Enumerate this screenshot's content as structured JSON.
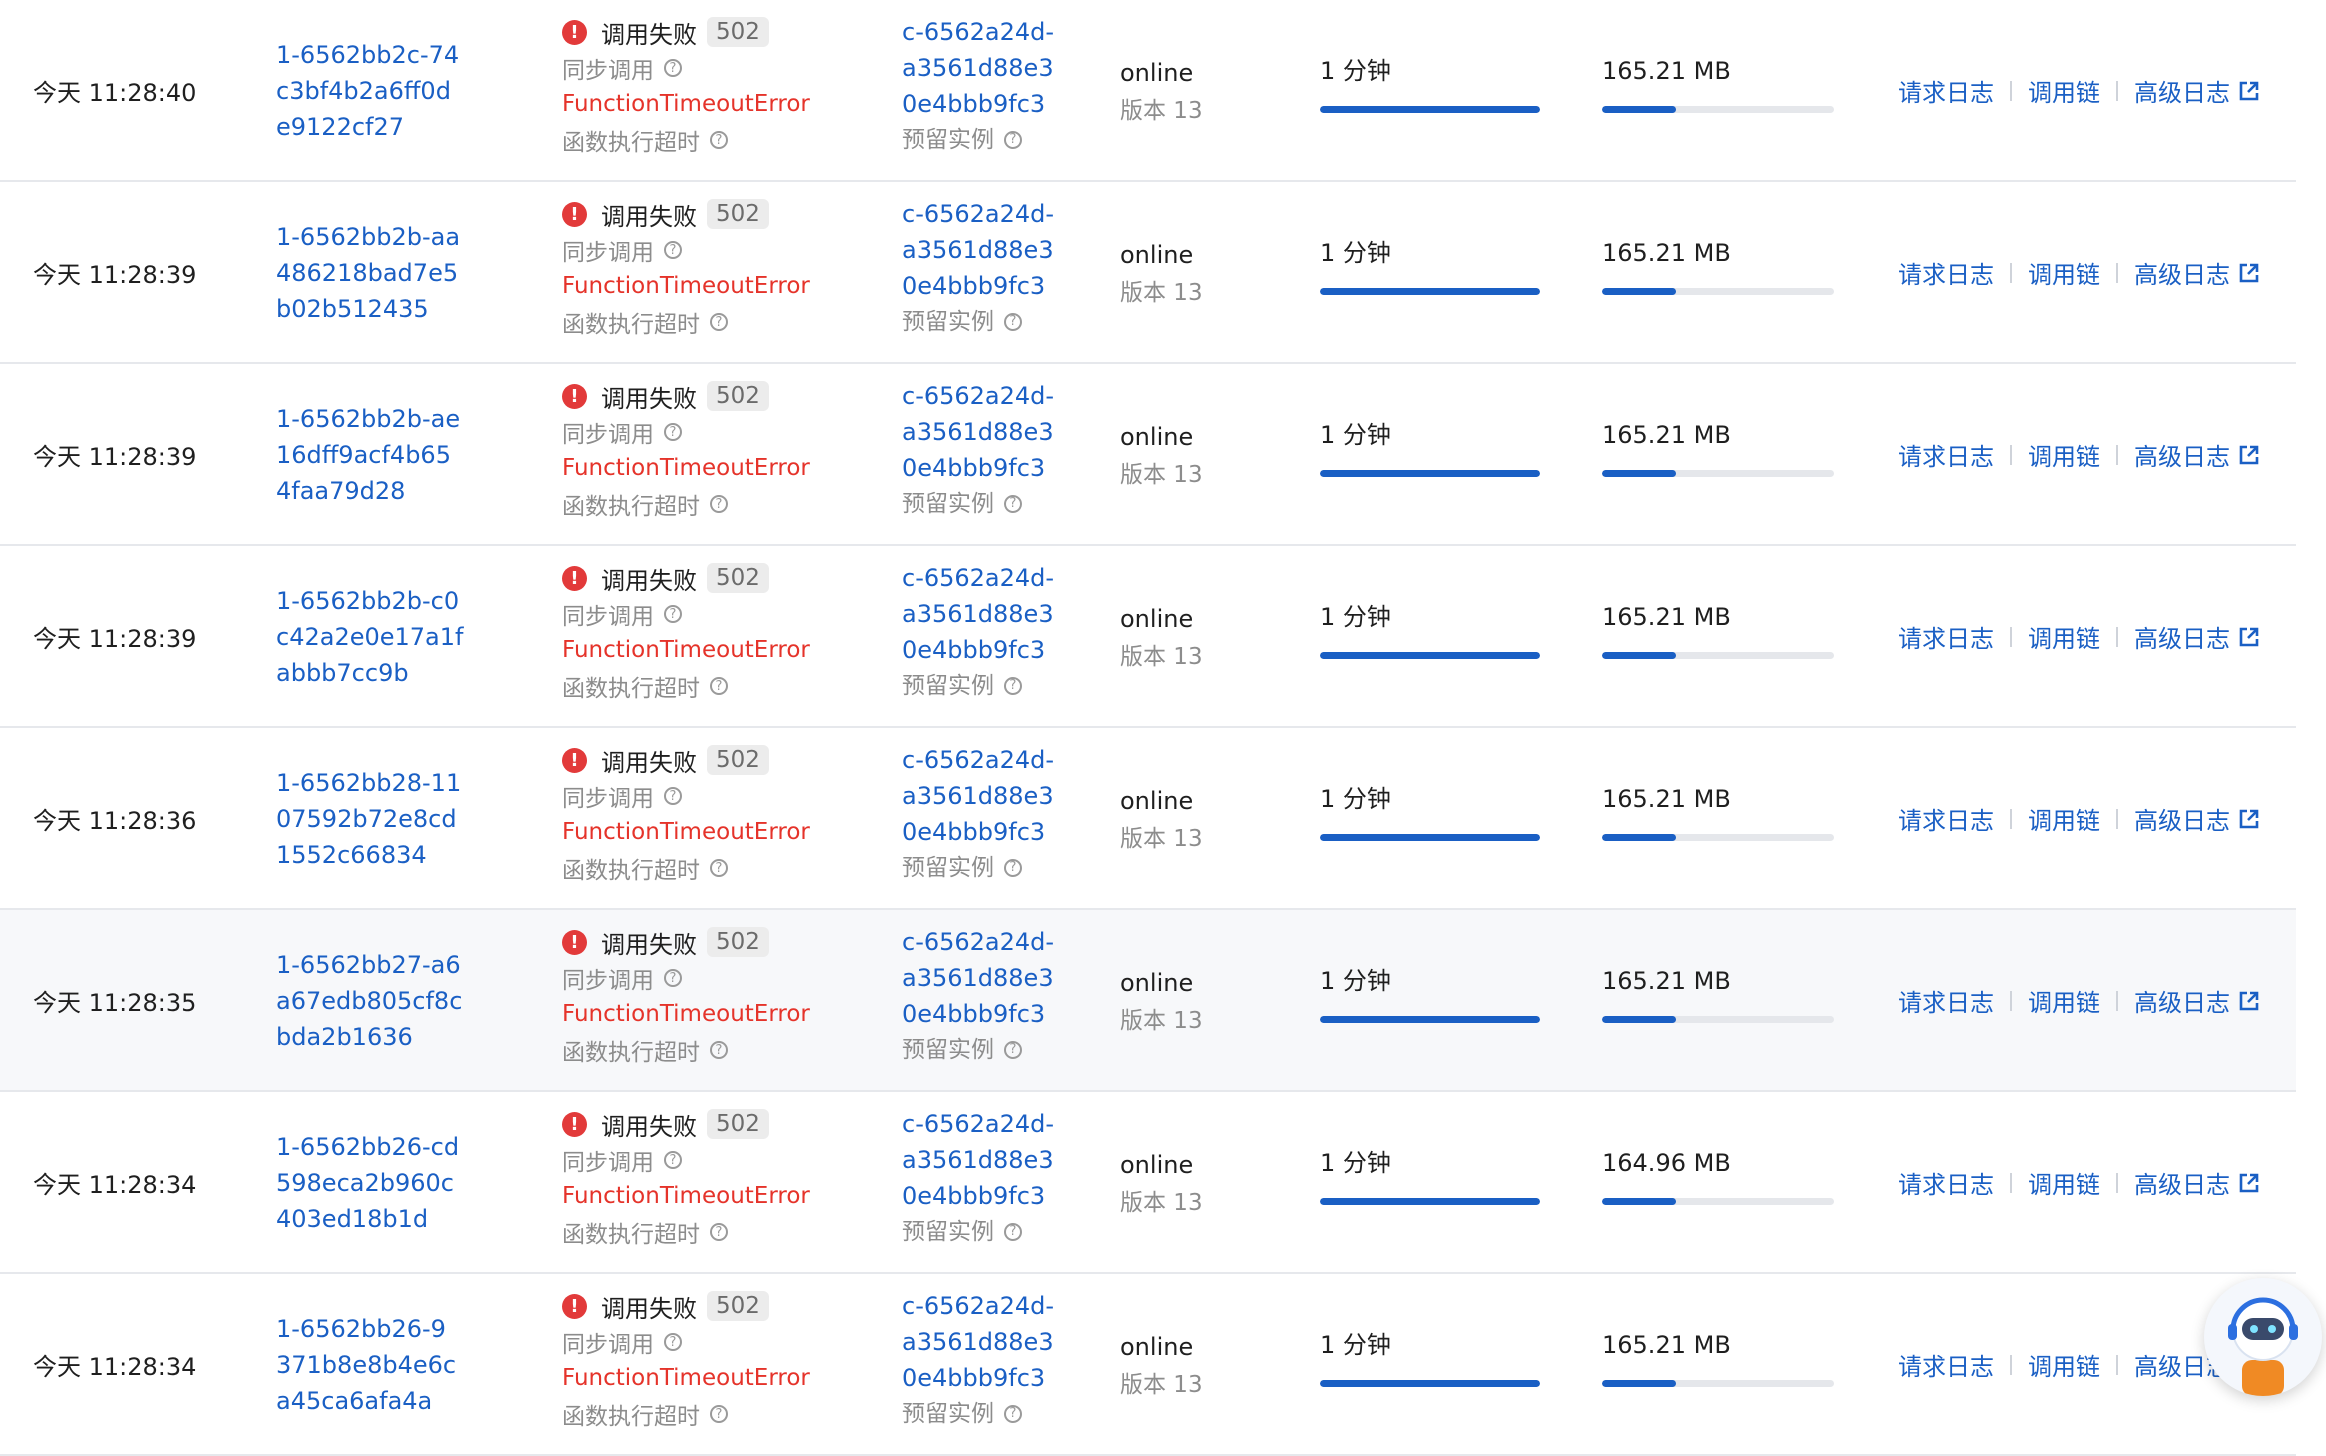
{
  "colors": {
    "link": "#1a5fc4",
    "error": "#e5332a",
    "error_icon": "#e23a3a",
    "progress": "#1a5fc4"
  },
  "labels": {
    "status": "调用失败",
    "invoke_type": "同步调用",
    "error_desc": "函数执行超时",
    "instance_type": "预留实例",
    "version_status": "online",
    "action_request_log": "请求日志",
    "action_trace": "调用链",
    "action_advanced_log": "高级日志"
  },
  "icons": {
    "error": "error-circle-icon",
    "help": "question-circle-icon",
    "external": "external-link-icon",
    "assistant": "assistant-robot-icon"
  },
  "rows": [
    {
      "time": "今天 11:28:40",
      "request_id": [
        "1-6562bb2c-74",
        "c3bf4b2a6ff0d",
        "e9122cf27"
      ],
      "status_code": "502",
      "error_name": "FunctionTimeoutError",
      "instance_id": [
        "c-6562a24d-",
        "a3561d88e3",
        "0e4bbb9fc3"
      ],
      "version": "版本 13",
      "duration": "1 分钟",
      "duration_fraction": 1.0,
      "memory": "165.21 MB",
      "memory_fraction": 0.32,
      "highlighted": false
    },
    {
      "time": "今天 11:28:39",
      "request_id": [
        "1-6562bb2b-aa",
        "486218bad7e5",
        "b02b512435"
      ],
      "status_code": "502",
      "error_name": "FunctionTimeoutError",
      "instance_id": [
        "c-6562a24d-",
        "a3561d88e3",
        "0e4bbb9fc3"
      ],
      "version": "版本 13",
      "duration": "1 分钟",
      "duration_fraction": 1.0,
      "memory": "165.21 MB",
      "memory_fraction": 0.32,
      "highlighted": false
    },
    {
      "time": "今天 11:28:39",
      "request_id": [
        "1-6562bb2b-ae",
        "16dff9acf4b65",
        "4faa79d28"
      ],
      "status_code": "502",
      "error_name": "FunctionTimeoutError",
      "instance_id": [
        "c-6562a24d-",
        "a3561d88e3",
        "0e4bbb9fc3"
      ],
      "version": "版本 13",
      "duration": "1 分钟",
      "duration_fraction": 1.0,
      "memory": "165.21 MB",
      "memory_fraction": 0.32,
      "highlighted": false
    },
    {
      "time": "今天 11:28:39",
      "request_id": [
        "1-6562bb2b-c0",
        "c42a2e0e17a1f",
        "abbb7cc9b"
      ],
      "status_code": "502",
      "error_name": "FunctionTimeoutError",
      "instance_id": [
        "c-6562a24d-",
        "a3561d88e3",
        "0e4bbb9fc3"
      ],
      "version": "版本 13",
      "duration": "1 分钟",
      "duration_fraction": 1.0,
      "memory": "165.21 MB",
      "memory_fraction": 0.32,
      "highlighted": false
    },
    {
      "time": "今天 11:28:36",
      "request_id": [
        "1-6562bb28-11",
        "07592b72e8cd",
        "1552c66834"
      ],
      "status_code": "502",
      "error_name": "FunctionTimeoutError",
      "instance_id": [
        "c-6562a24d-",
        "a3561d88e3",
        "0e4bbb9fc3"
      ],
      "version": "版本 13",
      "duration": "1 分钟",
      "duration_fraction": 1.0,
      "memory": "165.21 MB",
      "memory_fraction": 0.32,
      "highlighted": false
    },
    {
      "time": "今天 11:28:35",
      "request_id": [
        "1-6562bb27-a6",
        "a67edb805cf8c",
        "bda2b1636"
      ],
      "status_code": "502",
      "error_name": "FunctionTimeoutError",
      "instance_id": [
        "c-6562a24d-",
        "a3561d88e3",
        "0e4bbb9fc3"
      ],
      "version": "版本 13",
      "duration": "1 分钟",
      "duration_fraction": 1.0,
      "memory": "165.21 MB",
      "memory_fraction": 0.32,
      "highlighted": true
    },
    {
      "time": "今天 11:28:34",
      "request_id": [
        "1-6562bb26-cd",
        "598eca2b960c",
        "403ed18b1d"
      ],
      "status_code": "502",
      "error_name": "FunctionTimeoutError",
      "instance_id": [
        "c-6562a24d-",
        "a3561d88e3",
        "0e4bbb9fc3"
      ],
      "version": "版本 13",
      "duration": "1 分钟",
      "duration_fraction": 1.0,
      "memory": "164.96 MB",
      "memory_fraction": 0.32,
      "highlighted": false
    },
    {
      "time": "今天 11:28:34",
      "request_id": [
        "1-6562bb26-9",
        "371b8e8b4e6c",
        "a45ca6afa4a"
      ],
      "status_code": "502",
      "error_name": "FunctionTimeoutError",
      "instance_id": [
        "c-6562a24d-",
        "a3561d88e3",
        "0e4bbb9fc3"
      ],
      "version": "版本 13",
      "duration": "1 分钟",
      "duration_fraction": 1.0,
      "memory": "165.21 MB",
      "memory_fraction": 0.32,
      "highlighted": false
    }
  ]
}
